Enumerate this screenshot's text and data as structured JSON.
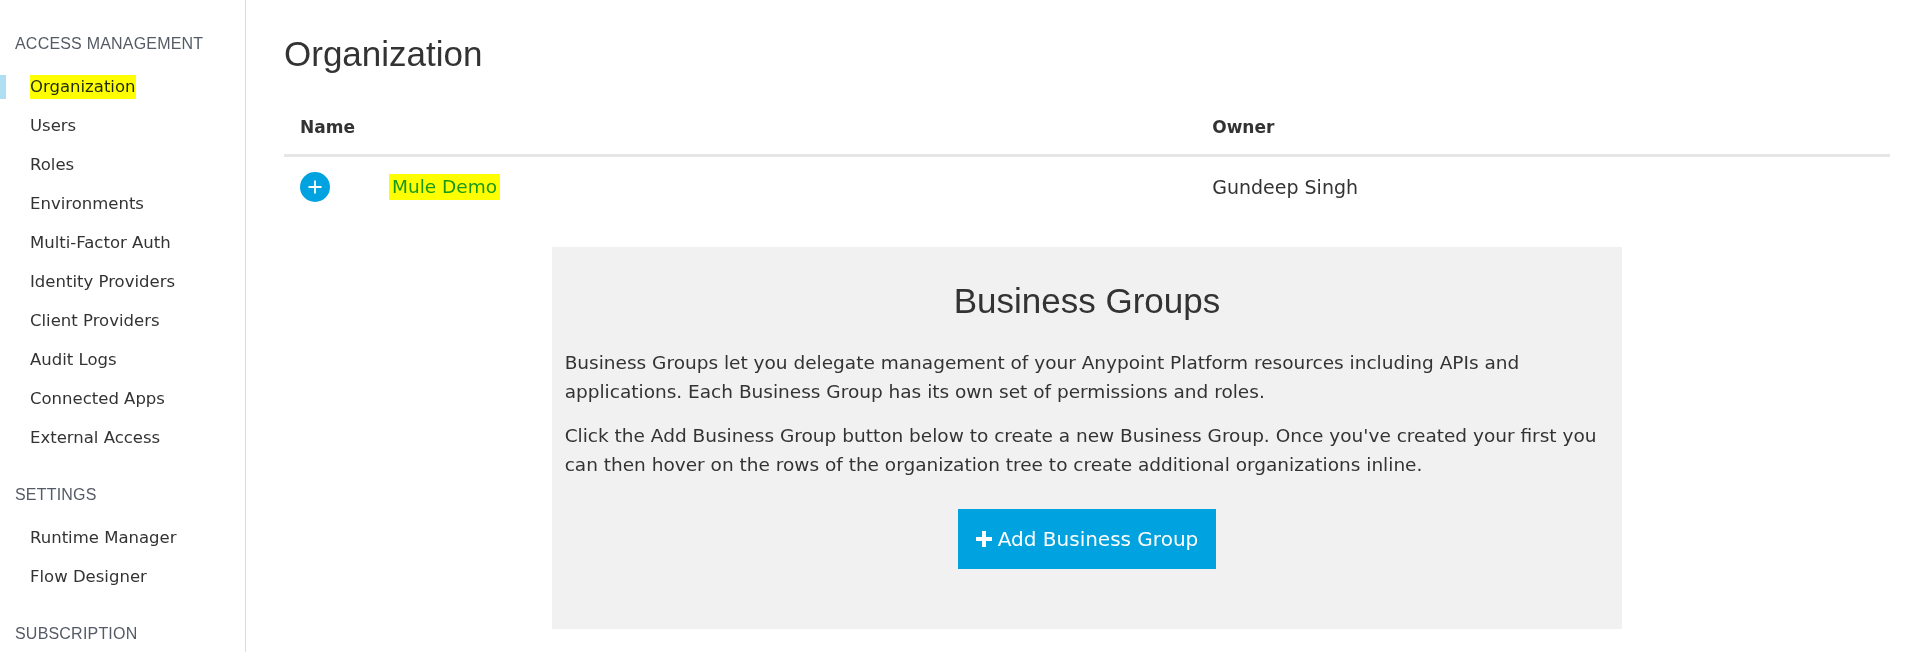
{
  "sidebar": {
    "sections": [
      {
        "heading": "ACCESS MANAGEMENT",
        "items": [
          {
            "label": "Organization",
            "selected": true,
            "highlighted": true
          },
          {
            "label": "Users",
            "selected": false,
            "highlighted": false
          },
          {
            "label": "Roles",
            "selected": false,
            "highlighted": false
          },
          {
            "label": "Environments",
            "selected": false,
            "highlighted": false
          },
          {
            "label": "Multi-Factor Auth",
            "selected": false,
            "highlighted": false
          },
          {
            "label": "Identity Providers",
            "selected": false,
            "highlighted": false
          },
          {
            "label": "Client Providers",
            "selected": false,
            "highlighted": false
          },
          {
            "label": "Audit Logs",
            "selected": false,
            "highlighted": false
          },
          {
            "label": "Connected Apps",
            "selected": false,
            "highlighted": false
          },
          {
            "label": "External Access",
            "selected": false,
            "highlighted": false
          }
        ]
      },
      {
        "heading": "SETTINGS",
        "items": [
          {
            "label": "Runtime Manager",
            "selected": false,
            "highlighted": false
          },
          {
            "label": "Flow Designer",
            "selected": false,
            "highlighted": false
          }
        ]
      },
      {
        "heading": "SUBSCRIPTION"
      }
    ]
  },
  "page_title": "Organization",
  "table": {
    "columns": [
      "Name",
      "Owner"
    ],
    "rows": [
      {
        "name": "Mule Demo",
        "owner": "Gundeep Singh",
        "expanded": false,
        "highlighted": true
      }
    ]
  },
  "business_groups": {
    "title": "Business Groups",
    "paragraphs": [
      "Business Groups let you delegate management of your Anypoint Platform resources including APIs and applications. Each Business Group has its own set of permissions and roles.",
      "Click the Add Business Group button below to create a new Business Group. Once you've created your first you can then hover on the rows of the organization tree to create additional organizations inline."
    ],
    "button": "Add Business Group"
  }
}
